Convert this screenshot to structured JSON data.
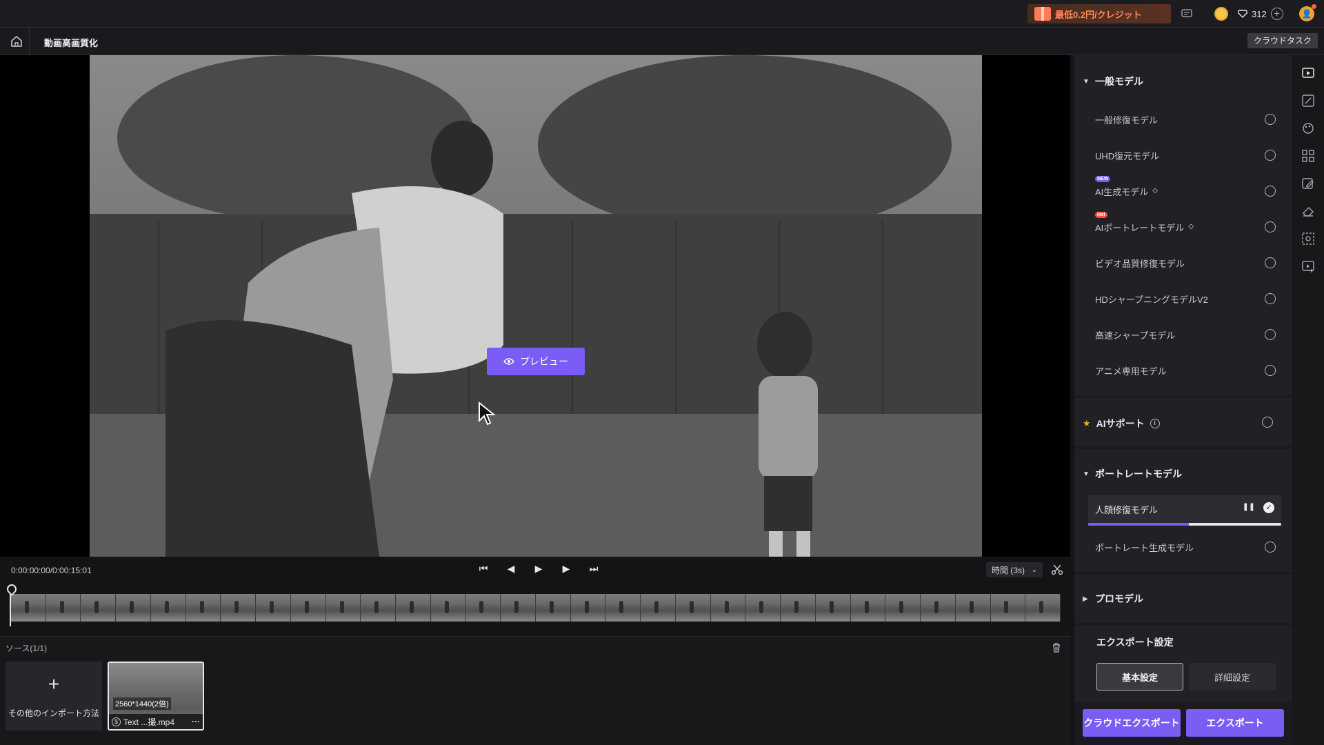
{
  "topbar": {
    "promo_text": "最低0.2円/クレジット",
    "credits": "312"
  },
  "subbar": {
    "page_title": "動画高画質化",
    "cloud_task_label": "クラウドタスク"
  },
  "preview": {
    "preview_button_label": "プレビュー"
  },
  "controls": {
    "timecode": "0:00:00:00/0:00:15:01",
    "duration_select": "時間 (3s)"
  },
  "source": {
    "label": "ソース(1/1)",
    "import_label": "その他のインポート方法",
    "clip": {
      "resolution": "2560*1440(2倍)",
      "name": "Text ...撮.mp4"
    }
  },
  "right_panel": {
    "general_section": "一般モデル",
    "general_models": [
      {
        "label": "一般修復モデル"
      },
      {
        "label": "UHD復元モデル"
      },
      {
        "label": "AI生成モデル",
        "badge": "NEW"
      },
      {
        "label": "AIポートレートモデル",
        "badge": "Hot"
      },
      {
        "label": "ビデオ品質修復モデル"
      },
      {
        "label": "HDシャープニングモデルV2"
      },
      {
        "label": "高速シャープモデル"
      },
      {
        "label": "アニメ専用モデル"
      }
    ],
    "ai_support_label": "AIサポート",
    "portrait_section": "ポートレートモデル",
    "portrait_models": [
      {
        "label": "人顔修復モデル",
        "progress": 0.52
      },
      {
        "label": "ポートレート生成モデル"
      }
    ],
    "pro_section": "プロモデル",
    "export_settings_title": "エクスポート設定",
    "tab_basic": "基本設定",
    "tab_detail": "詳細設定",
    "cloud_export_label": "クラウドエクスポート",
    "export_label": "エクスポート"
  },
  "colors": {
    "accent": "#7b5cf5",
    "promo": "#ff8a5a"
  }
}
